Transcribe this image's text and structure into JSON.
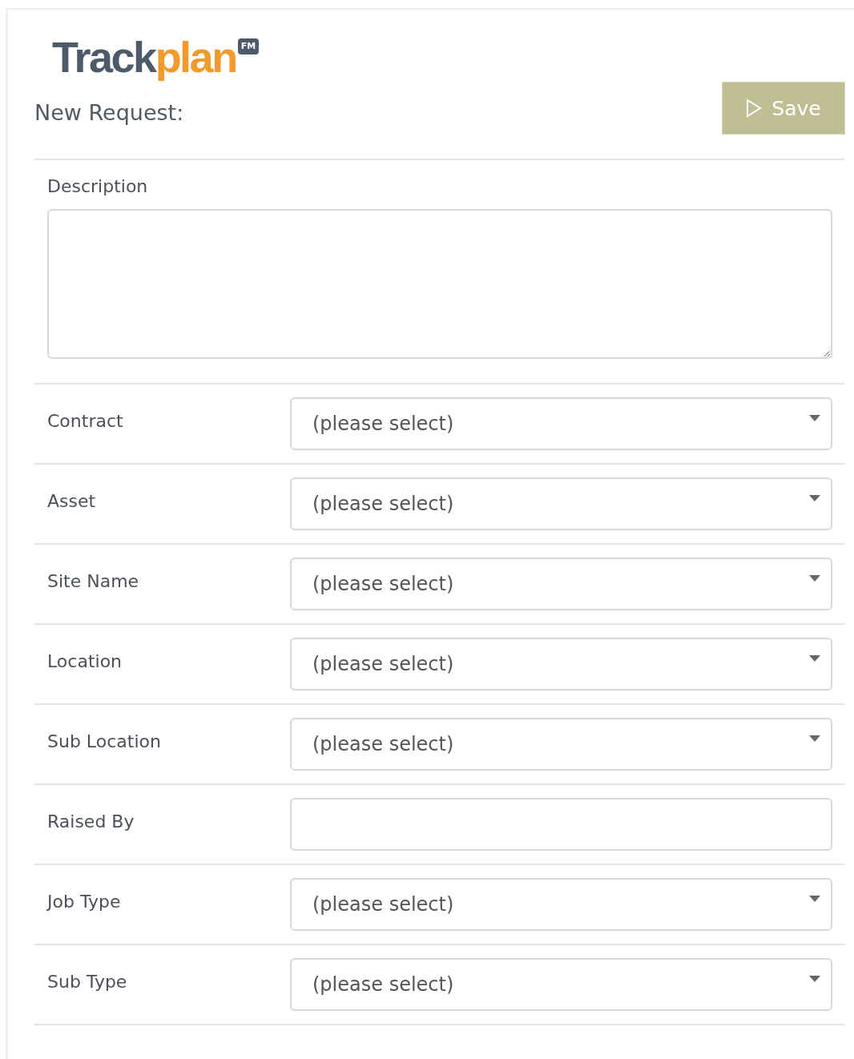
{
  "logo": {
    "parts": [
      "Track",
      "plan"
    ],
    "badge": "FM"
  },
  "heading": "New Request:",
  "save_button": {
    "label": "Save"
  },
  "description": {
    "label": "Description"
  },
  "fields": [
    {
      "label": "Contract",
      "kind": "select",
      "value": "(please select)"
    },
    {
      "label": "Asset",
      "kind": "select",
      "value": "(please select)"
    },
    {
      "label": "Site Name",
      "kind": "select",
      "value": "(please select)"
    },
    {
      "label": "Location",
      "kind": "select",
      "value": "(please select)"
    },
    {
      "label": "Sub Location",
      "kind": "select",
      "value": "(please select)"
    },
    {
      "label": "Raised By",
      "kind": "text"
    },
    {
      "label": "Job Type",
      "kind": "select",
      "value": "(please select)"
    },
    {
      "label": "Sub Type",
      "kind": "select",
      "value": "(please select)"
    }
  ]
}
